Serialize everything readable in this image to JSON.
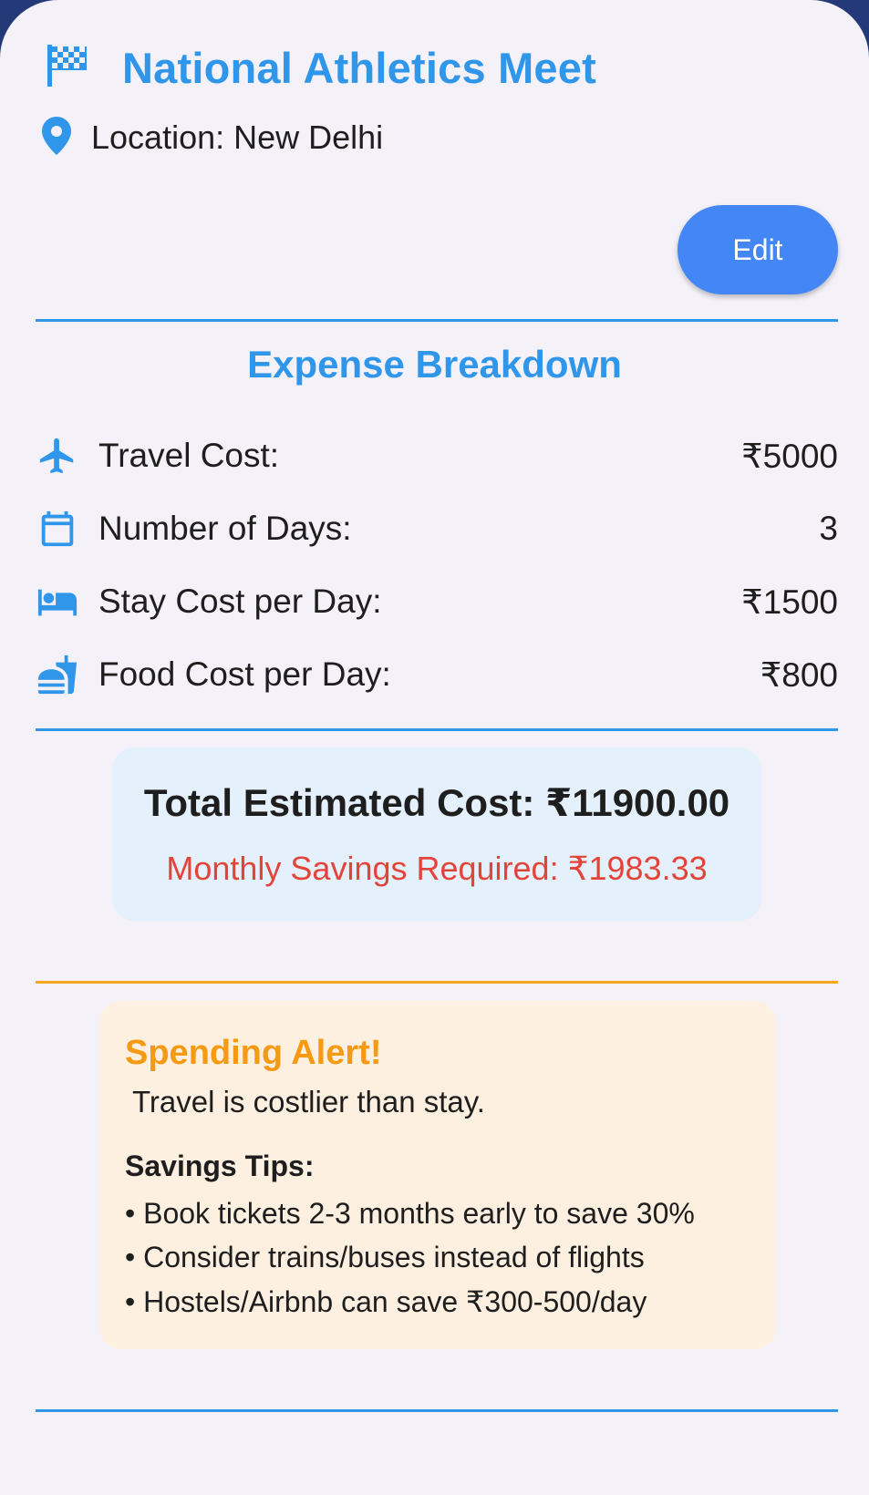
{
  "event": {
    "title": "National Athletics Meet",
    "location": "Location: New Delhi",
    "title_icon": "checkered-flag-icon",
    "location_icon": "location-pin-icon"
  },
  "actions": {
    "edit_label": "Edit"
  },
  "breakdown": {
    "title": "Expense Breakdown",
    "rows": [
      {
        "icon": "airplane-icon",
        "label": "Travel Cost:",
        "value": "₹5000"
      },
      {
        "icon": "calendar-icon",
        "label": "Number of Days:",
        "value": "3"
      },
      {
        "icon": "bed-icon",
        "label": "Stay Cost per Day:",
        "value": "₹1500"
      },
      {
        "icon": "fastfood-icon",
        "label": "Food Cost per Day:",
        "value": "₹800"
      }
    ]
  },
  "summary": {
    "total": "Total Estimated Cost: ₹11900.00",
    "monthly": "Monthly Savings Required: ₹1983.33"
  },
  "alert": {
    "title": "Spending Alert!",
    "message": "Travel is costlier than stay.",
    "tips_title": "Savings Tips:",
    "tips": [
      "• Book tickets 2-3 months early to save 30%",
      "• Consider trains/buses instead of flights",
      "• Hostels/Airbnb can save ₹300-500/day"
    ]
  },
  "colors": {
    "accent": "#2f96ea",
    "button": "#4287f5",
    "warning": "#f59a12",
    "danger": "#e3443a",
    "background": "#f5f1f9"
  }
}
